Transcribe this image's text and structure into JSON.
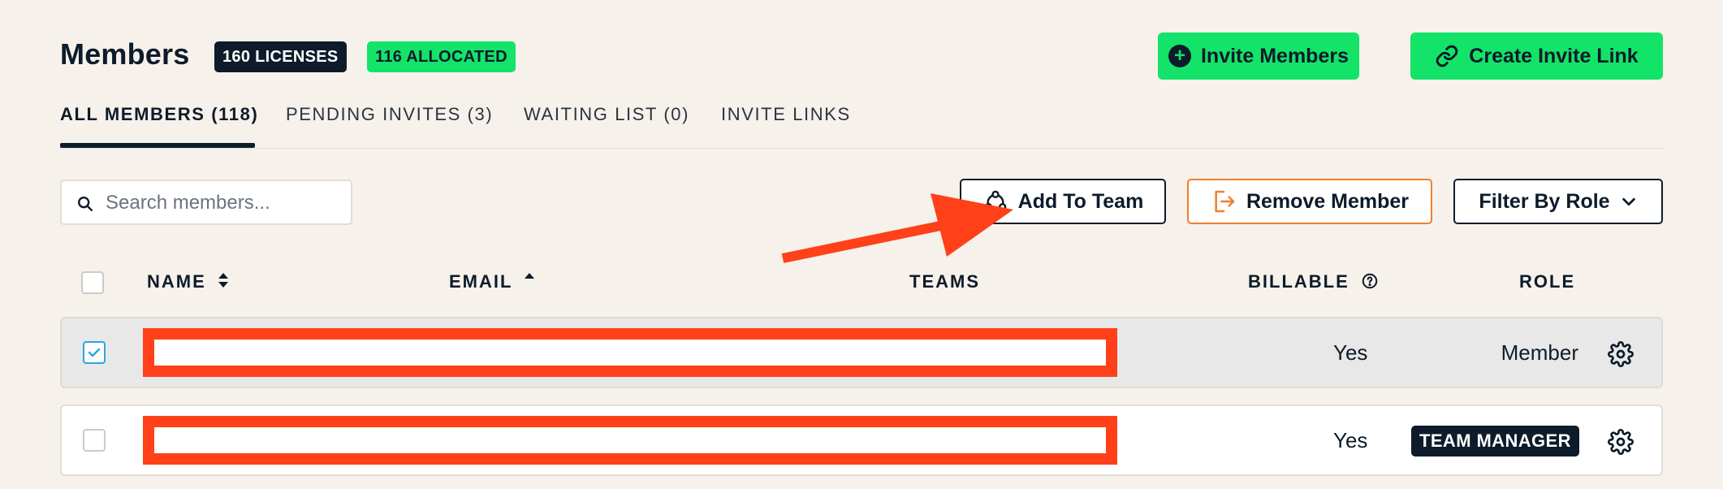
{
  "header": {
    "title": "Members",
    "licenses_badge": "160 LICENSES",
    "allocated_badge": "116 ALLOCATED",
    "invite_button": "Invite Members",
    "invite_link_button": "Create Invite Link"
  },
  "tabs": [
    {
      "label": "ALL MEMBERS (118)",
      "active": true
    },
    {
      "label": "PENDING INVITES (3)",
      "active": false
    },
    {
      "label": "WAITING LIST (0)",
      "active": false
    },
    {
      "label": "INVITE LINKS",
      "active": false
    }
  ],
  "toolbar": {
    "search_placeholder": "Search members...",
    "add_to_team": "Add To Team",
    "remove_member": "Remove Member",
    "filter_by_role": "Filter By Role"
  },
  "table": {
    "columns": {
      "name": "NAME",
      "email": "EMAIL",
      "teams": "TEAMS",
      "billable": "BILLABLE",
      "role": "ROLE"
    },
    "rows": [
      {
        "selected": true,
        "billable": "Yes",
        "role": "Member",
        "role_style": "text"
      },
      {
        "selected": false,
        "billable": "Yes",
        "role": "TEAM MANAGER",
        "role_style": "badge"
      }
    ]
  },
  "colors": {
    "accent_green": "#14e36a",
    "navy": "#0d1b2a",
    "annotation_red": "#ff4019",
    "remove_orange": "#f07f2c"
  }
}
